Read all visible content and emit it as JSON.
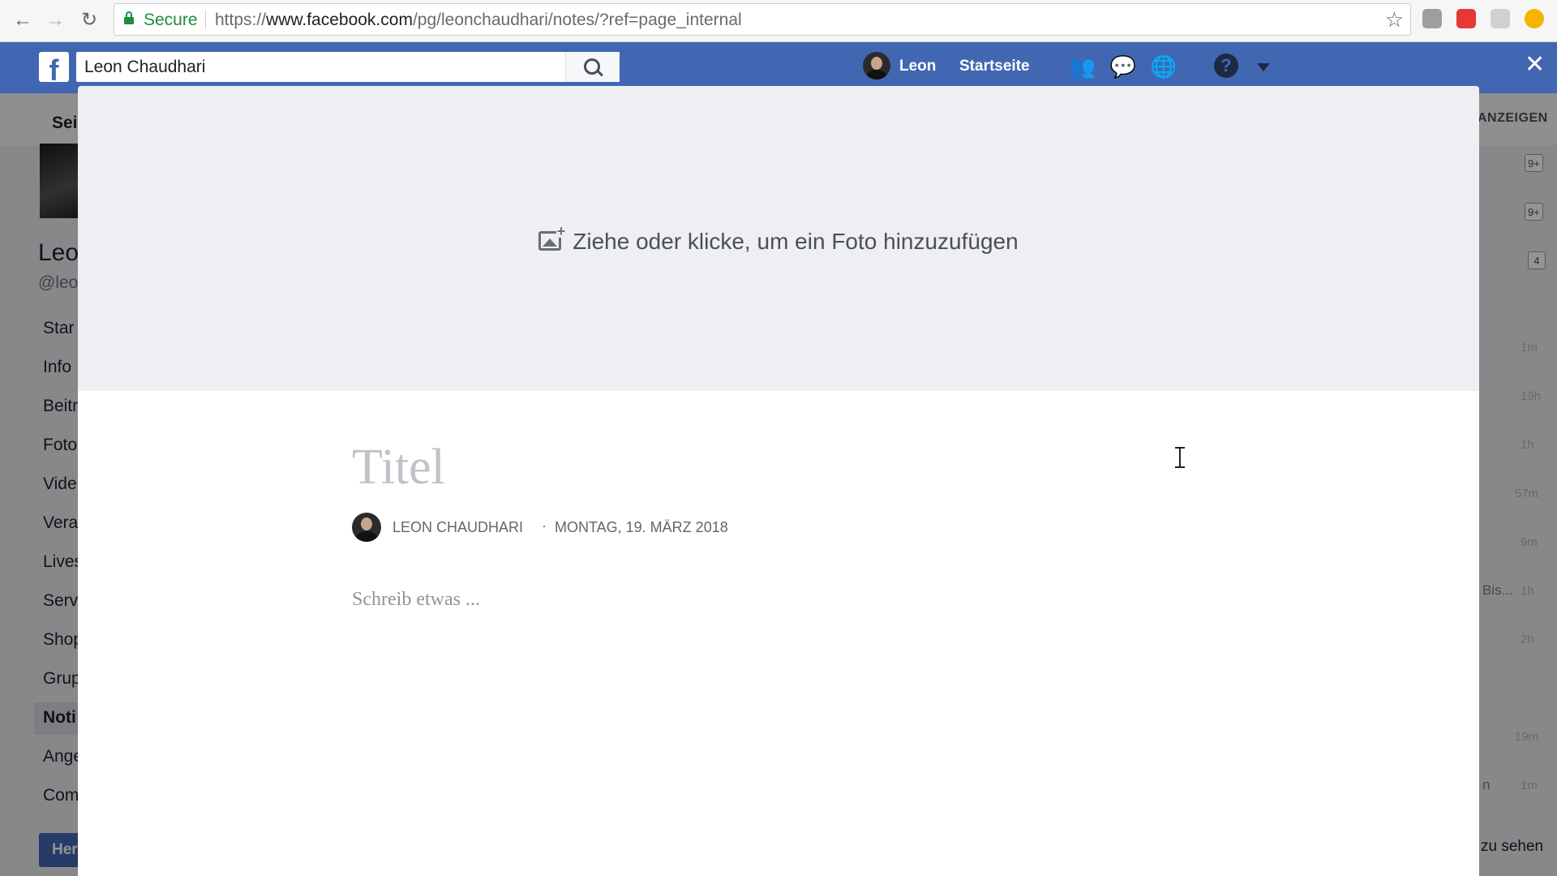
{
  "browser": {
    "secure_label": "Secure",
    "url_scheme": "https://",
    "url_host": "www.facebook.com",
    "url_path": "/pg/leonchaudhari/notes/?ref=page_internal",
    "icons": [
      "back-arrow-icon",
      "forward-arrow-icon",
      "reload-icon",
      "lock-icon",
      "star-icon"
    ],
    "extension_colors": [
      "#9e9e9e",
      "#e53935",
      "#bdbdbd",
      "#f4b400"
    ]
  },
  "fb": {
    "brand_color": "#4267b2",
    "logo": "f",
    "search_value": "Leon Chaudhari",
    "profile_name": "Leon",
    "home_label": "Startseite",
    "help_glyph": "?",
    "close_glyph": "✕"
  },
  "background_page": {
    "tab_label": "Sei",
    "page_name": "Leo",
    "page_handle": "@leo",
    "nav": [
      "Star",
      "Info",
      "Beitr",
      "Foto",
      "Vide",
      "Vera",
      "Lives",
      "Serv",
      "Shop",
      "Grup",
      "Noti",
      "Ange",
      "Com"
    ],
    "active_nav": "Noti",
    "button_label": "Her",
    "right_label": "ANZEIGEN",
    "badges": [
      "9+",
      "9+",
      "4"
    ],
    "times": [
      "1m",
      "19h",
      "1h",
      "57m",
      "9m",
      "1h",
      "2h",
      "19m",
      "1m"
    ],
    "snippets": [
      "Bis...",
      "n"
    ],
    "see_label": "zu sehen"
  },
  "composer": {
    "photo_hint": "Ziehe oder klicke, um ein Foto hinzuzufügen",
    "title_placeholder": "Titel",
    "author": "LEON CHAUDHARI",
    "separator": "·",
    "date": "MONTAG, 19. MÄRZ 2018",
    "body_placeholder": "Schreib etwas ..."
  }
}
